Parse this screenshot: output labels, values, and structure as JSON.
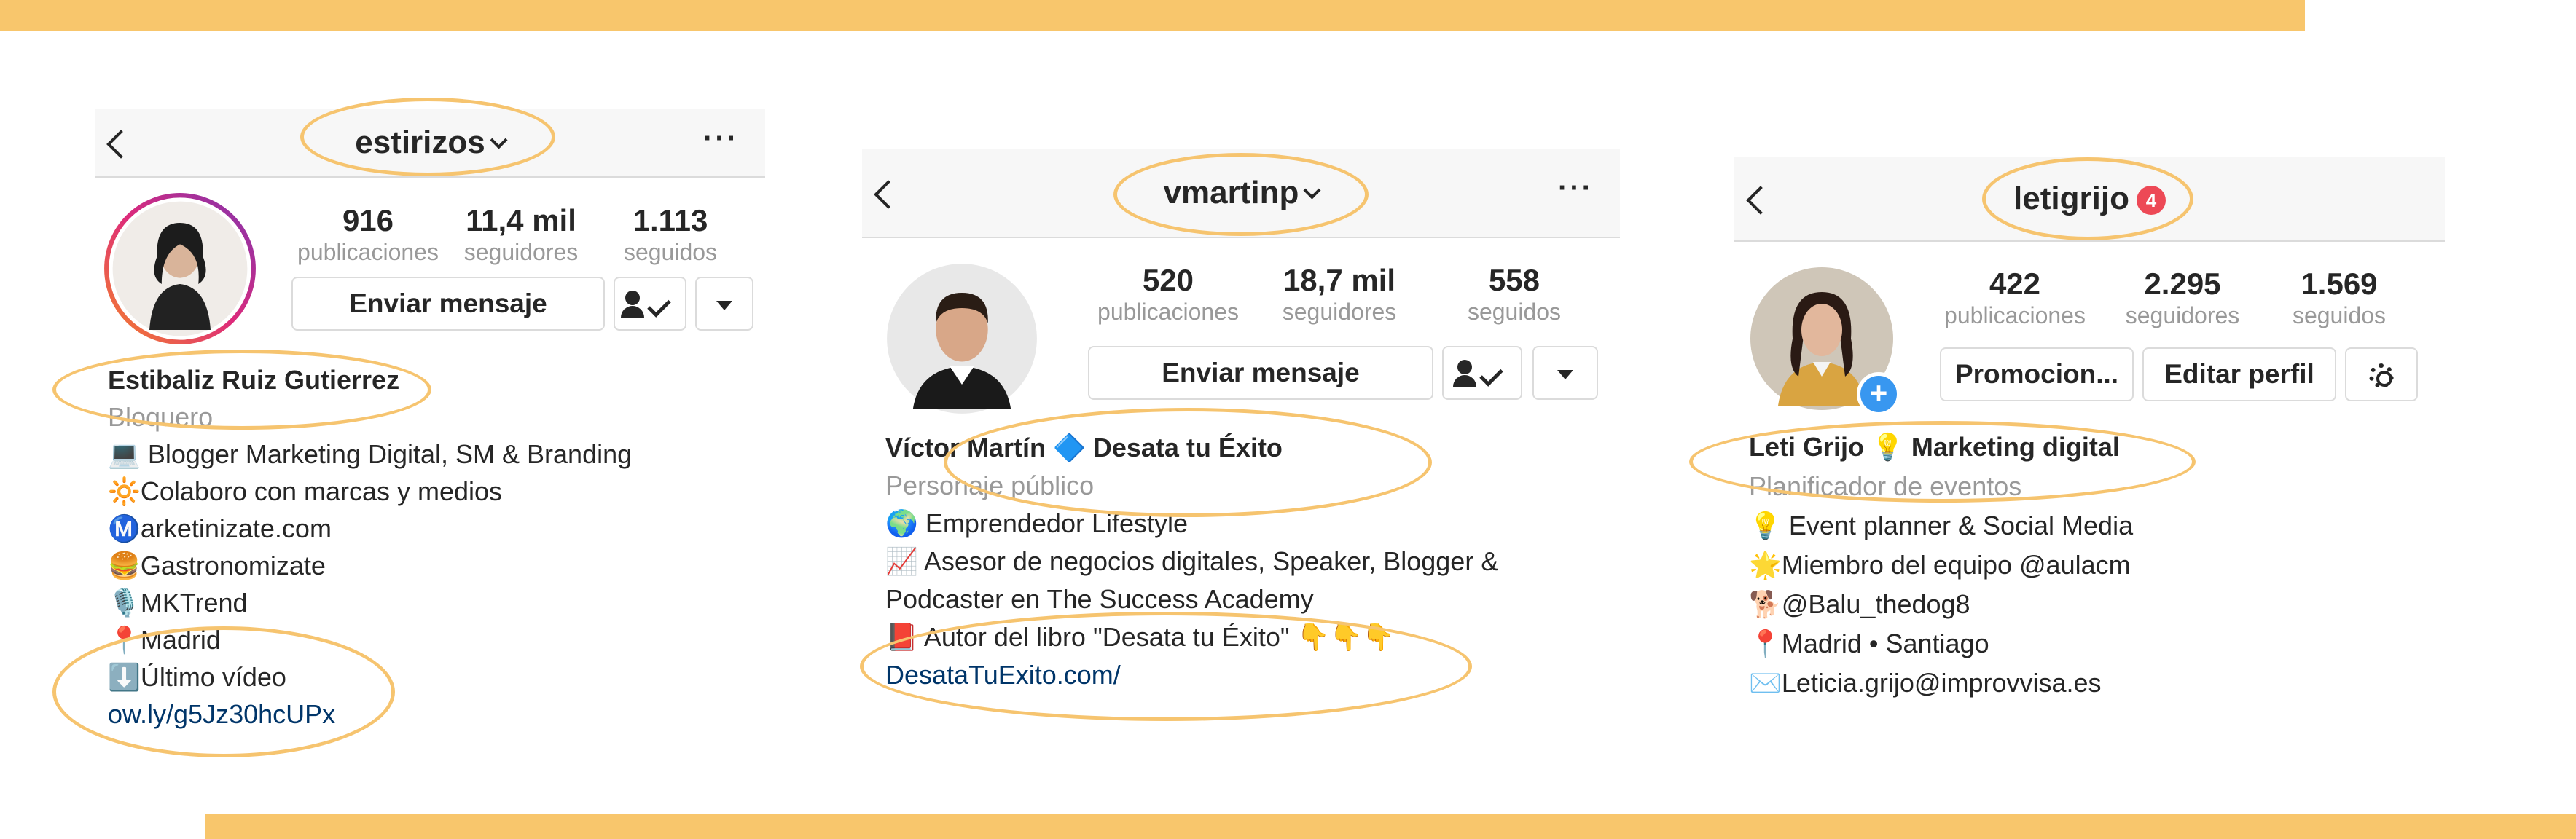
{
  "colors": {
    "accent_band": "#f8c66c",
    "highlight_oval": "#f6c46f",
    "link": "#003569",
    "secondary_text": "#999999",
    "badge": "#ed4956",
    "add_story": "#3897f0"
  },
  "profiles": [
    {
      "username": "estirizos",
      "stats": [
        {
          "value": "916",
          "label": "publicaciones"
        },
        {
          "value": "11,4 mil",
          "label": "seguidores"
        },
        {
          "value": "1.113",
          "label": "seguidos"
        }
      ],
      "buttons": {
        "message": "Enviar mensaje"
      },
      "name": "Estibaliz Ruiz Gutierrez",
      "category": "Bloquero",
      "bio": [
        "💻 Blogger Marketing Digital, SM & Branding",
        "🔆Colaboro con marcas y medios",
        "Ⓜ️arketinizate.com",
        "🍔Gastronomizate",
        "🎙️MKTrend",
        "📍Madrid",
        "⬇️Último vídeo"
      ],
      "link": "ow.ly/g5Jz30hcUPx",
      "icons": [
        "back-arrow-icon",
        "chevron-down-icon",
        "more-options-icon",
        "follow-check-icon",
        "dropdown-caret-icon"
      ]
    },
    {
      "username": "vmartinp",
      "stats": [
        {
          "value": "520",
          "label": "publicaciones"
        },
        {
          "value": "18,7 mil",
          "label": "seguidores"
        },
        {
          "value": "558",
          "label": "seguidos"
        }
      ],
      "buttons": {
        "message": "Enviar mensaje"
      },
      "name": "Víctor Martín 🔷 Desata tu Éxito",
      "category": "Personaje público",
      "bio": [
        "🌍 Emprendedor Lifestyle",
        "📈 Asesor de negocios digitales, Speaker, Blogger &",
        "Podcaster en The Success Academy",
        "📕 Autor del libro \"Desata tu Éxito\" 👇👇👇"
      ],
      "link": "DesataTuExito.com/",
      "icons": [
        "back-arrow-icon",
        "chevron-down-icon",
        "more-options-icon",
        "follow-check-icon",
        "dropdown-caret-icon"
      ]
    },
    {
      "username": "letigrijo",
      "notification_count": "4",
      "stats": [
        {
          "value": "422",
          "label": "publicaciones"
        },
        {
          "value": "2.295",
          "label": "seguidores"
        },
        {
          "value": "1.569",
          "label": "seguidos"
        }
      ],
      "buttons": {
        "promote": "Promocion...",
        "edit": "Editar perfil"
      },
      "name": "Leti Grijo 💡 Marketing digital",
      "category": "Planificador de eventos",
      "bio": [
        "💡 Event planner & Social Media",
        "🌟Miembro del equipo @aulacm",
        "🐕@Balu_thedog8",
        "📍Madrid • Santiago",
        "✉️Leticia.grijo@improvvisa.es"
      ],
      "icons": [
        "back-arrow-icon",
        "settings-gear-icon",
        "add-story-icon"
      ]
    }
  ]
}
